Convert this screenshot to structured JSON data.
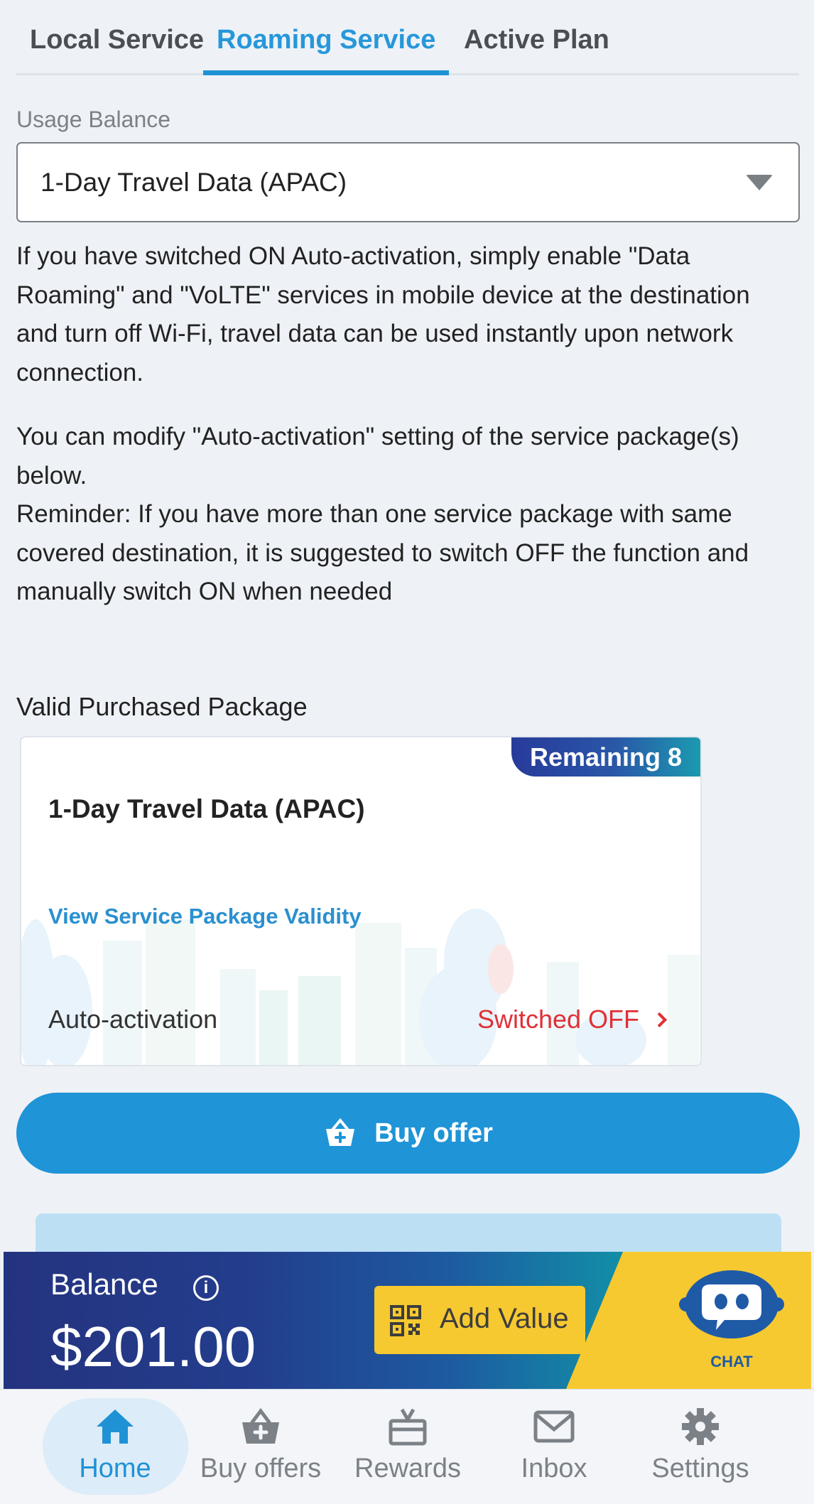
{
  "tabs": [
    {
      "label": "Local Service"
    },
    {
      "label": "Roaming Service"
    },
    {
      "label": "Active Plan"
    }
  ],
  "usage": {
    "label": "Usage Balance",
    "selected": "1-Day Travel Data (APAC)"
  },
  "paragraphs": {
    "p1": "If you have switched ON Auto-activation, simply enable \"Data Roaming\" and \"VoLTE\" services in mobile device at the destination and turn off Wi-Fi, travel data can be used instantly upon network connection.",
    "p2": "You can modify \"Auto-activation\" setting of the service package(s) below.",
    "p3": "Reminder: If you have more than one service package with same covered destination, it is suggested to switch OFF the function and manually switch ON when needed"
  },
  "package": {
    "section_label": "Valid Purchased Package",
    "badge": "Remaining 8",
    "title": "1-Day Travel Data (APAC)",
    "validity_link": "View Service Package Validity",
    "auto_label": "Auto-activation",
    "auto_status": "Switched OFF"
  },
  "buy_button": {
    "label": "Buy offer"
  },
  "balance": {
    "label": "Balance",
    "value": "$201.00",
    "add_value": "Add Value",
    "chat": "CHAT"
  },
  "nav": [
    {
      "label": "Home"
    },
    {
      "label": "Buy offers"
    },
    {
      "label": "Rewards"
    },
    {
      "label": "Inbox"
    },
    {
      "label": "Settings"
    }
  ],
  "colors": {
    "accent": "#1f92d6",
    "status_off": "#e03036",
    "balance_yellow": "#f7c930",
    "balance_navy": "#24337f"
  }
}
